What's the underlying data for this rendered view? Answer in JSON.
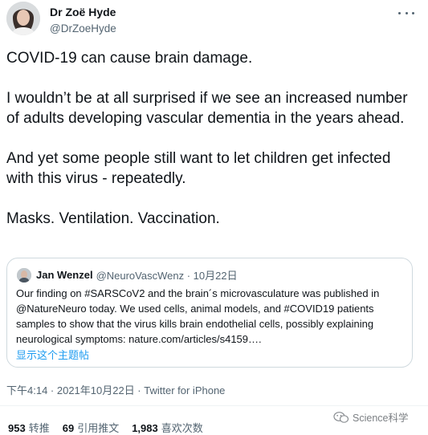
{
  "author": {
    "name": "Dr Zoë Hyde",
    "handle": "@DrZoeHyde"
  },
  "tweet": {
    "paragraphs": [
      "COVID-19 can cause brain damage.",
      "I wouldn’t be at all surprised if we see an increased number of adults developing vascular dementia in the years ahead.",
      "And yet some people still want to let children get infected with this virus - repeatedly.",
      "Masks. Ventilation. Vaccination."
    ]
  },
  "quote": {
    "name": "Jan Wenzel",
    "handle_date": "@NeuroVascWenz · 10月22日",
    "text": "Our finding on #SARSCoV2 and the brain´s microvasculature was published in @NatureNeuro today. We used cells, animal models, and #COVID19 patients samples to show that the virus kills brain endothelial cells, possibly explaining neurological symptoms: nature.com/articles/s4159….",
    "show_thread": "显示这个主题帖"
  },
  "meta": {
    "timestamp_source": "下午4:14 · 2021年10月22日 · Twitter for iPhone"
  },
  "stats": {
    "retweets_count": "953",
    "retweets_label": "转推",
    "quotes_count": "69",
    "quotes_label": "引用推文",
    "likes_count": "1,983",
    "likes_label": "喜欢次数"
  },
  "watermark": {
    "text": "Science科学"
  },
  "colors": {
    "accent": "#1d9bf0",
    "secondary_text": "#536471",
    "border": "#cfd9de"
  },
  "icons": [
    "avatar",
    "more-options-icon",
    "quote-avatar",
    "wechat-icon"
  ]
}
